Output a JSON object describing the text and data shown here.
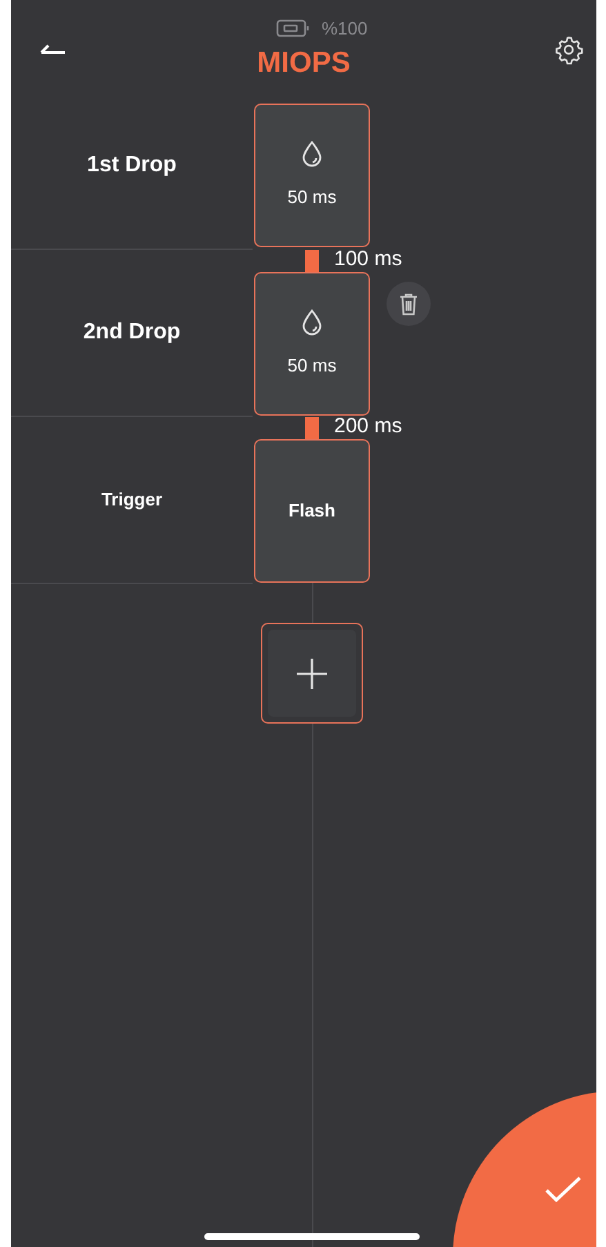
{
  "status": {
    "battery": "%100"
  },
  "header": {
    "title": "MIOPS"
  },
  "steps": [
    {
      "label": "1st Drop",
      "kind": "drop",
      "value": "50 ms",
      "deletable": false
    },
    {
      "label": "2nd Drop",
      "kind": "drop",
      "value": "50 ms",
      "delay_before": "100 ms",
      "deletable": true
    },
    {
      "label": "Trigger",
      "kind": "trigger",
      "value": "Flash",
      "delay_before": "200 ms",
      "deletable": false
    }
  ]
}
